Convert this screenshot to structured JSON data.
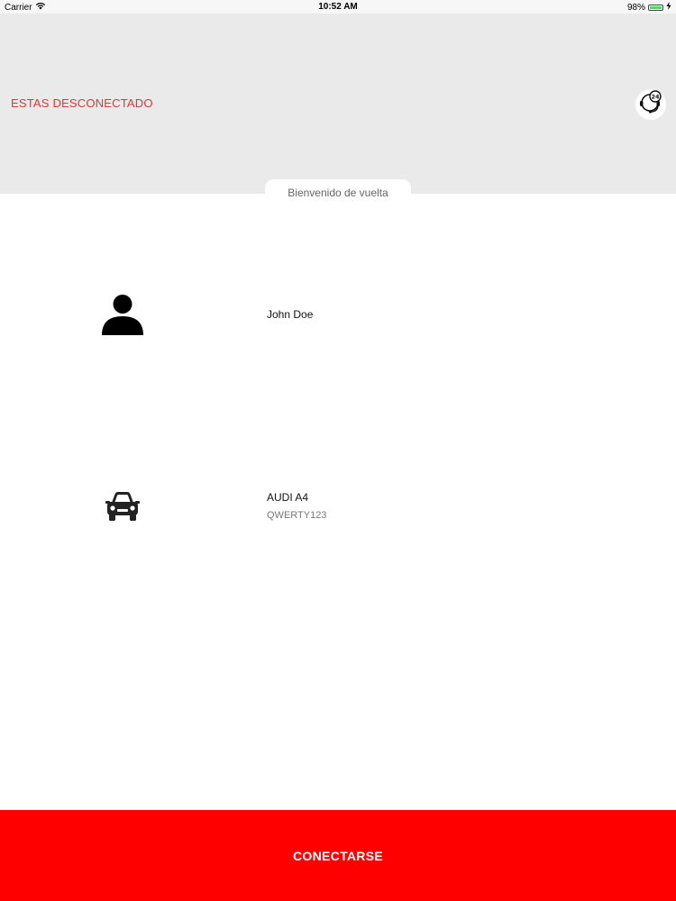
{
  "status_bar": {
    "carrier": "Carrier",
    "time": "10:52 AM",
    "battery_text": "98%",
    "battery_level_percent": 98,
    "wifi_icon": "wifi-icon",
    "battery_icon": "battery-icon",
    "charging_icon": "charging-icon"
  },
  "header": {
    "status_text": "ESTAS DESCONECTADO",
    "support_icon": "support-24h-icon"
  },
  "welcome": {
    "text": "Bienvenido de vuelta"
  },
  "user": {
    "icon": "user-icon",
    "name": "John Doe"
  },
  "vehicle": {
    "icon": "car-icon",
    "model": "AUDI A4",
    "plate": "QWERTY123"
  },
  "connect_button": {
    "label": "CONECTARSE"
  },
  "colors": {
    "accent": "#ff0000",
    "status_text": "#e23636",
    "header_bg": "#ebeaeb",
    "page_bg": "#ffffff"
  }
}
